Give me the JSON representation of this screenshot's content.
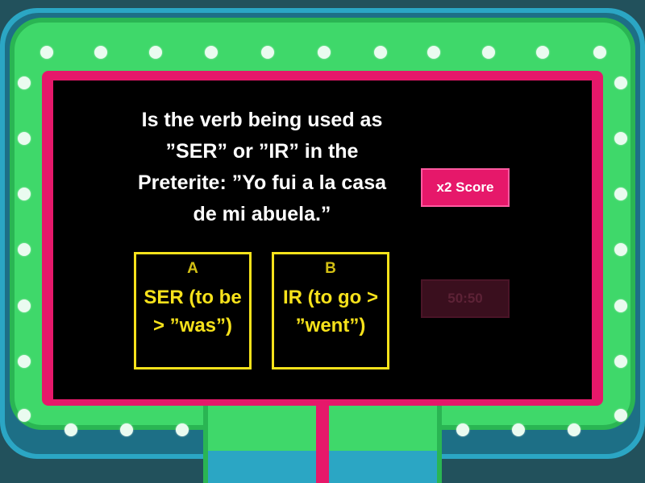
{
  "question": {
    "text": "Is the verb being used as ”SER” or ”IR” in the Preterite: ”Yo fui a la casa de mi abuela.”"
  },
  "answers": [
    {
      "letter": "A",
      "label": "SER (to be > ”was”)"
    },
    {
      "letter": "B",
      "label": "IR (to go > ”went”)"
    }
  ],
  "powerups": {
    "double_score": "x2 Score",
    "fifty_fifty": "50:50",
    "fifty_fifty_state": "disabled"
  },
  "theme": {
    "frame_teal": "#2ba6c4",
    "marquee_green": "#3fd86a",
    "screen_border_pink": "#e6186a",
    "answer_yellow": "#f7e21b"
  }
}
